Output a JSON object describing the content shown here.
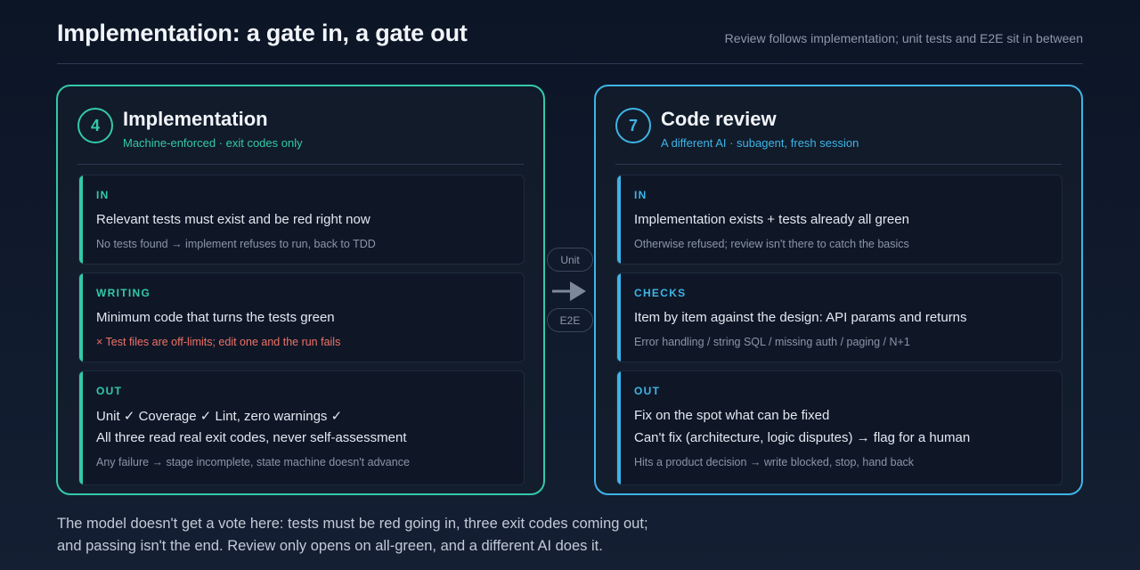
{
  "header": {
    "title": "Implementation: a gate in, a gate out",
    "subtitle": "Review follows implementation; unit tests and E2E sit in between"
  },
  "colors": {
    "implementation_accent": "#34c9a8",
    "review_accent": "#3fb4e6",
    "warning": "#f07166",
    "background": "#0c1526"
  },
  "implementation": {
    "number": "4",
    "title": "Implementation",
    "subtitle": "Machine-enforced · exit codes only",
    "in": {
      "tag": "IN",
      "line1": "Relevant tests must exist and be red right now",
      "note": "No tests found → implement refuses to run, back to TDD"
    },
    "writing": {
      "tag": "WRITING",
      "line1": "Minimum code that turns the tests green",
      "warning": "× Test files are off-limits; edit one and the run fails"
    },
    "out": {
      "tag": "OUT",
      "line1": "Unit ✓ Coverage ✓ Lint, zero warnings ✓",
      "line2": "All three read real exit codes, never self-assessment",
      "note": "Any failure → stage incomplete, state machine doesn't advance"
    }
  },
  "connector": {
    "top_label": "Unit",
    "bottom_label": "E2E",
    "arrow_icon": "arrow-right-icon"
  },
  "review": {
    "number": "7",
    "title": "Code review",
    "subtitle": "A different AI · subagent, fresh session",
    "in": {
      "tag": "IN",
      "line1": "Implementation exists + tests already all green",
      "note": "Otherwise refused; review isn't there to catch the basics"
    },
    "checks": {
      "tag": "CHECKS",
      "line1": "Item by item against the design: API params and returns",
      "note": "Error handling / string SQL / missing auth / paging / N+1"
    },
    "out": {
      "tag": "OUT",
      "line1": "Fix on the spot what can be fixed",
      "line2": "Can't fix (architecture, logic disputes) → flag for a human",
      "note": "Hits a product decision → write blocked, stop, hand back"
    }
  },
  "footer": {
    "line1": "The model doesn't get a vote here: tests must be red going in, three exit codes coming out;",
    "line2": "and passing isn't the end. Review only opens on all-green, and a different AI does it."
  }
}
